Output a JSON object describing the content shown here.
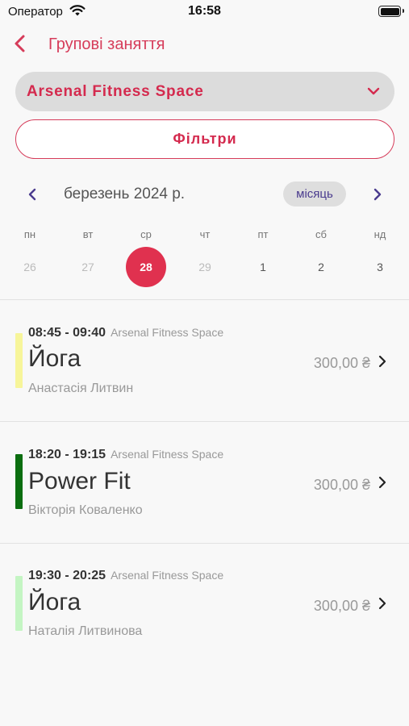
{
  "status_bar": {
    "carrier": "Оператор",
    "time": "16:58"
  },
  "header": {
    "title": "Групові заняття"
  },
  "club_select": {
    "value": "Arsenal Fitness Space"
  },
  "filters": {
    "label": "Фільтри"
  },
  "calendar": {
    "month_label": "березень 2024 р.",
    "view_mode": "місяць",
    "weekdays": [
      "пн",
      "вт",
      "ср",
      "чт",
      "пт",
      "сб",
      "нд"
    ],
    "days": [
      {
        "label": "26",
        "state": "faded"
      },
      {
        "label": "27",
        "state": "faded"
      },
      {
        "label": "28",
        "state": "selected"
      },
      {
        "label": "29",
        "state": "faded"
      },
      {
        "label": "1",
        "state": "active"
      },
      {
        "label": "2",
        "state": "active"
      },
      {
        "label": "3",
        "state": "active"
      }
    ]
  },
  "sessions": [
    {
      "time": "08:45 - 09:40",
      "venue": "Arsenal Fitness Space",
      "name": "Йога",
      "trainer": "Анастасія Литвин",
      "price": "300,00 ₴",
      "color": "#f7f59a"
    },
    {
      "time": "18:20 - 19:15",
      "venue": "Arsenal Fitness Space",
      "name": "Power Fit",
      "trainer": "Вікторія Коваленко",
      "price": "300,00 ₴",
      "color": "#0b6e10"
    },
    {
      "time": "19:30 - 20:25",
      "venue": "Arsenal Fitness Space",
      "name": "Йога",
      "trainer": "Наталія Литвинова",
      "price": "300,00 ₴",
      "color": "#c4f5c3"
    }
  ]
}
